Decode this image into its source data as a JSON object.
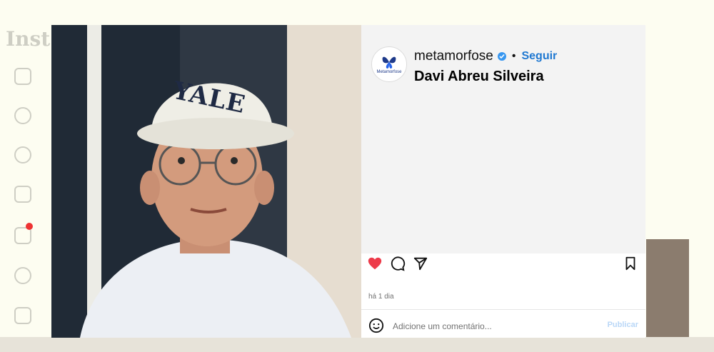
{
  "background": {
    "app_logo_text": "Inst"
  },
  "post": {
    "account": {
      "username": "metamorfose",
      "avatar_caption": "Metamorfose",
      "verified": true,
      "verified_icon": "verified-badge-icon",
      "follow_label": "Seguir",
      "separator": "•"
    },
    "caption": "Davi Abreu Silveira",
    "photo": {
      "description_icon": "person-selfie-photo",
      "cap_text": "YALE"
    },
    "actions": {
      "like_icon": "heart-filled-icon",
      "comment_icon": "comment-icon",
      "share_icon": "send-icon",
      "save_icon": "bookmark-icon",
      "liked": true
    },
    "time_ago": "há 1 dia",
    "comment": {
      "emoji_icon": "emoji-icon",
      "placeholder": "Adicione um comentário...",
      "value": "",
      "publish_label": "Publicar"
    }
  },
  "colors": {
    "accent": "#1f78d1",
    "like": "#ed3b4a",
    "verified": "#3897f0"
  }
}
